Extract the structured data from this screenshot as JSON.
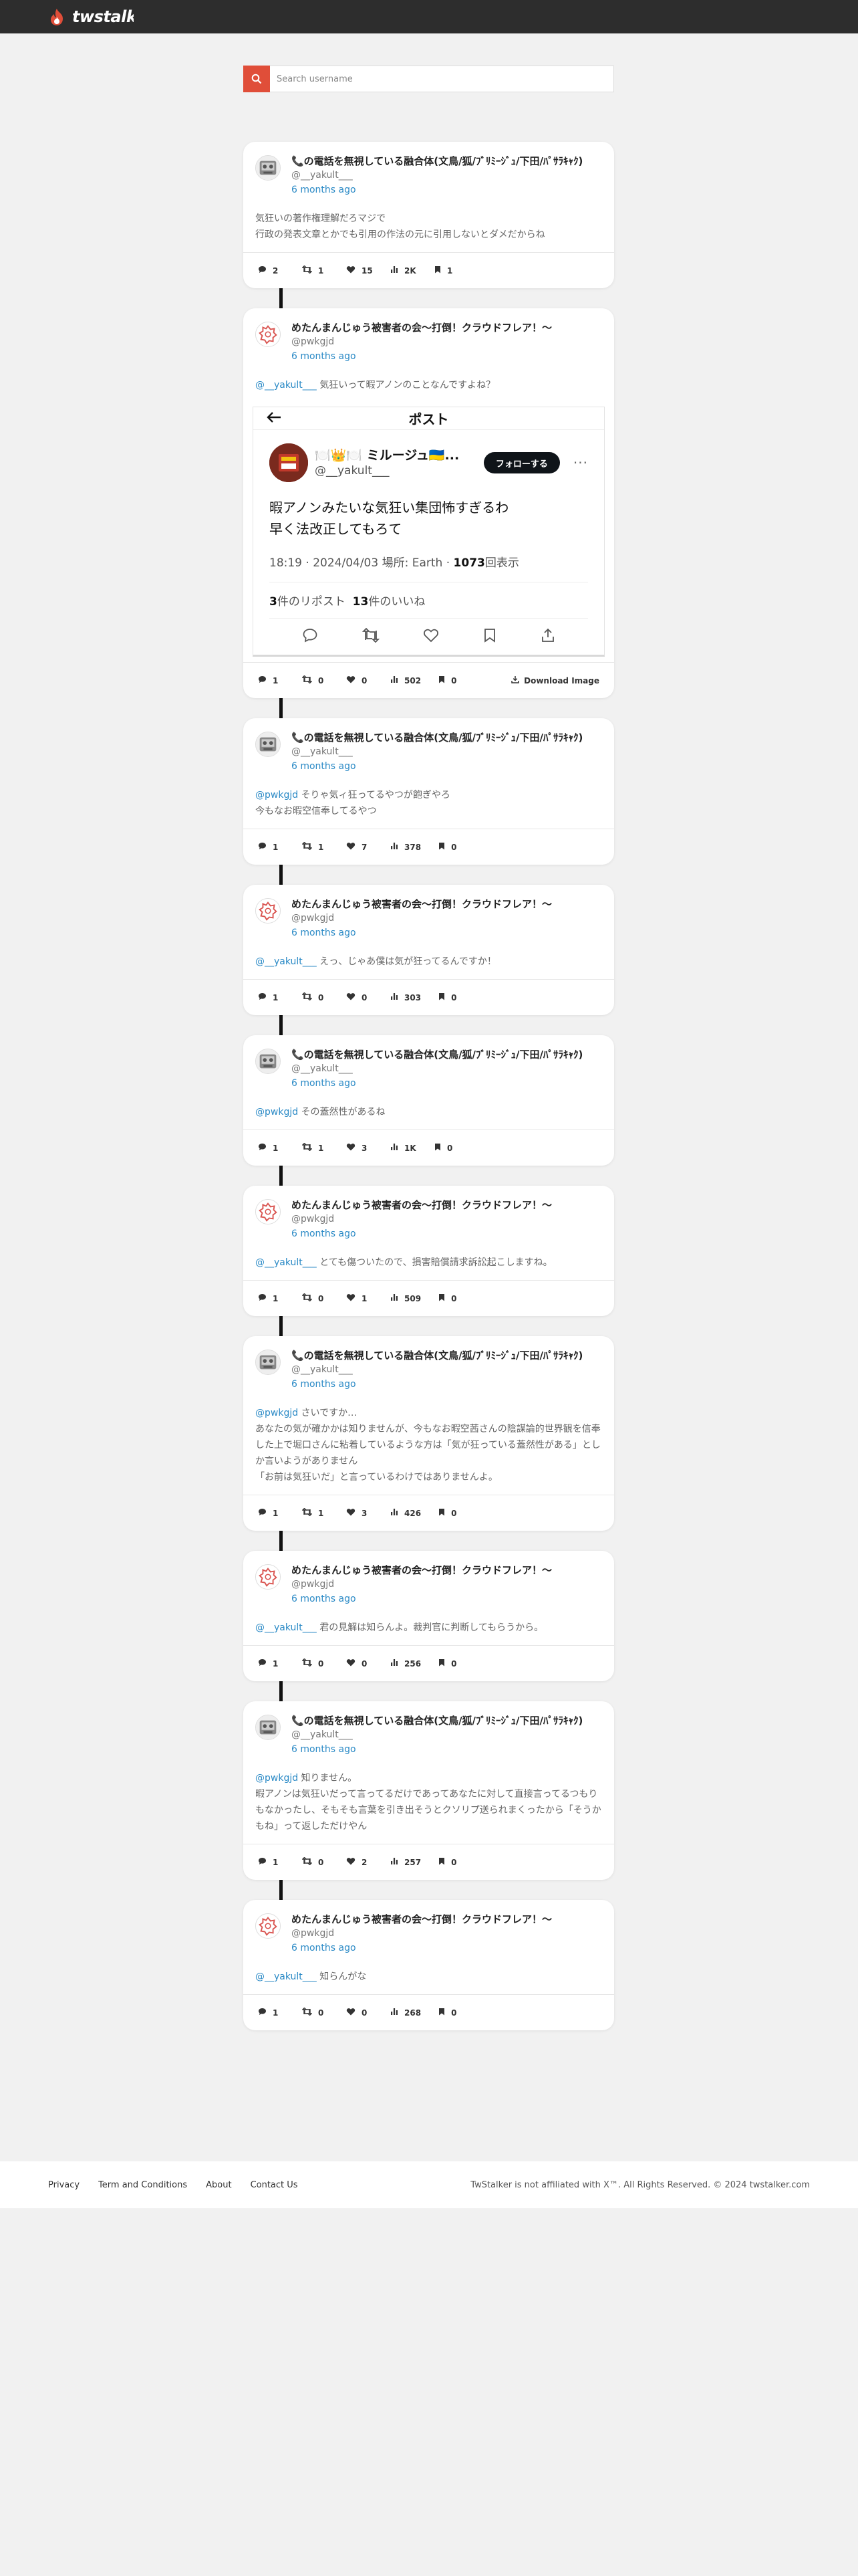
{
  "brand": {
    "name": "twstalker",
    "accent": "#e04e39"
  },
  "search": {
    "placeholder": "Search username"
  },
  "users": {
    "a": {
      "name": "📞の電話を無視している融合体(文鳥/狐/ﾌﾞﾘﾐｰｼﾞｭ/下田/ﾊﾟｻﾗｷｬｸ)",
      "handle": "@__yakult___"
    },
    "b": {
      "name": "めたんまんじゅう被害者の会〜打倒！クラウドフレア！〜",
      "handle": "@pwkgjd"
    }
  },
  "posts": [
    {
      "user": "a",
      "time": "6 months ago",
      "mention": "",
      "text": "気狂いの著作権理解だろマジで\n行政の発表文章とかでも引用の作法の元に引用しないとダメだからね",
      "replies": "2",
      "retweets": "1",
      "likes": "15",
      "views": "2K",
      "bookmarks": "1"
    },
    {
      "user": "b",
      "time": "6 months ago",
      "mention": "@__yakult___",
      "text": " 気狂いって暇アノンのことなんですよね？",
      "replies": "1",
      "retweets": "0",
      "likes": "0",
      "views": "502",
      "bookmarks": "0",
      "download_label": "Download Image"
    },
    {
      "user": "a",
      "time": "6 months ago",
      "mention": "@pwkgjd",
      "text": " そりゃ気ィ狂ってるやつが飽ぎやろ\n今もなお暇空信奉してるやつ",
      "replies": "1",
      "retweets": "1",
      "likes": "7",
      "views": "378",
      "bookmarks": "0"
    },
    {
      "user": "b",
      "time": "6 months ago",
      "mention": "@__yakult___",
      "text": " えっ、じゃあ僕は気が狂ってるんですか！",
      "replies": "1",
      "retweets": "0",
      "likes": "0",
      "views": "303",
      "bookmarks": "0"
    },
    {
      "user": "a",
      "time": "6 months ago",
      "mention": "@pwkgjd",
      "text": " その蓋然性があるね",
      "replies": "1",
      "retweets": "1",
      "likes": "3",
      "views": "1K",
      "bookmarks": "0"
    },
    {
      "user": "b",
      "time": "6 months ago",
      "mention": "@__yakult___",
      "text": " とても傷ついたので、損害賠償請求訴訟起こしますね。",
      "replies": "1",
      "retweets": "0",
      "likes": "1",
      "views": "509",
      "bookmarks": "0"
    },
    {
      "user": "a",
      "time": "6 months ago",
      "mention": "@pwkgjd",
      "text": " さいですか…\nあなたの気が確かかは知りませんが、今もなお暇空茜さんの陰謀論的世界観を信奉した上で堀口さんに粘着しているような方は「気が狂っている蓋然性がある」としか言いようがありません\n「お前は気狂いだ」と言っているわけではありませんよ。",
      "replies": "1",
      "retweets": "1",
      "likes": "3",
      "views": "426",
      "bookmarks": "0"
    },
    {
      "user": "b",
      "time": "6 months ago",
      "mention": "@__yakult___",
      "text": " 君の見解は知らんよ。裁判官に判断してもらうから。",
      "replies": "1",
      "retweets": "0",
      "likes": "0",
      "views": "256",
      "bookmarks": "0"
    },
    {
      "user": "a",
      "time": "6 months ago",
      "mention": "@pwkgjd",
      "text": " 知りません。\n暇アノンは気狂いだって言ってるだけであってあなたに対して直接言ってるつもりもなかったし、そもそも言葉を引き出そうとクソリプ送られまくったから「そうかもね」って返しただけやん",
      "replies": "1",
      "retweets": "0",
      "likes": "2",
      "views": "257",
      "bookmarks": "0"
    },
    {
      "user": "b",
      "time": "6 months ago",
      "mention": "@__yakult___",
      "text": " 知らんがな",
      "replies": "1",
      "retweets": "0",
      "likes": "0",
      "views": "268",
      "bookmarks": "0"
    }
  ],
  "embedded": {
    "title": "ポスト",
    "name": "🍽️👑🍽️ ミルージュ🇺🇦...",
    "handle": "@__yakult___",
    "follow": "フォローする",
    "text": "暇アノンみたいな気狂い集団怖すぎるわ\n早く法改正してもろて",
    "meta_time": "18:19 · 2024/04/03 場所: Earth · ",
    "meta_views": "1073",
    "meta_views_label": "回表示",
    "reposts": "3",
    "reposts_label": "件のリポスト",
    "likes": "13",
    "likes_label": "件のいいね"
  },
  "footer": {
    "links": [
      "Privacy",
      "Term and Conditions",
      "About",
      "Contact Us"
    ],
    "copyright": "TwStalker is not affiliated with X™. All Rights Reserved. © 2024 twstalker.com"
  }
}
